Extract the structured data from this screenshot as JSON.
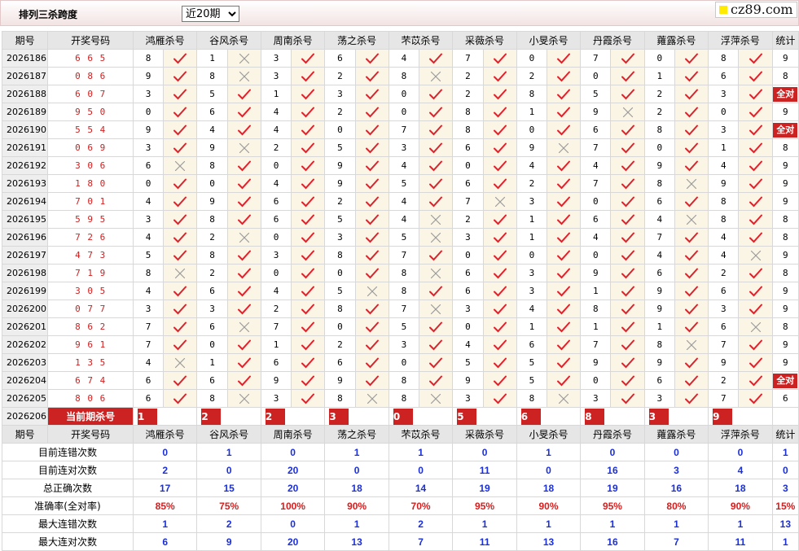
{
  "header": {
    "title": "排列三杀跨度",
    "period_select": {
      "value": "近20期",
      "options": [
        "近20期"
      ]
    },
    "logo": "cz89.com"
  },
  "columns": [
    "期号",
    "开奖号码",
    "鸿雁杀号",
    "谷风杀号",
    "周南杀号",
    "荡之杀号",
    "芣苡杀号",
    "采薇杀号",
    "小旻杀号",
    "丹霞杀号",
    "蕹露杀号",
    "浮萍杀号",
    "统计"
  ],
  "rows": [
    {
      "issue": "2026186",
      "code": "6 6 5",
      "picks": [
        [
          "8",
          1
        ],
        [
          "1",
          0
        ],
        [
          "3",
          1
        ],
        [
          "6",
          1
        ],
        [
          "4",
          1
        ],
        [
          "7",
          1
        ],
        [
          "0",
          1
        ],
        [
          "7",
          1
        ],
        [
          "0",
          1
        ],
        [
          "8",
          1
        ]
      ],
      "count": "9"
    },
    {
      "issue": "2026187",
      "code": "0 8 6",
      "picks": [
        [
          "9",
          1
        ],
        [
          "8",
          0
        ],
        [
          "3",
          1
        ],
        [
          "2",
          1
        ],
        [
          "8",
          0
        ],
        [
          "2",
          1
        ],
        [
          "2",
          1
        ],
        [
          "0",
          1
        ],
        [
          "1",
          1
        ],
        [
          "6",
          1
        ]
      ],
      "count": "8"
    },
    {
      "issue": "2026188",
      "code": "6 0 7",
      "picks": [
        [
          "3",
          1
        ],
        [
          "5",
          1
        ],
        [
          "1",
          1
        ],
        [
          "3",
          1
        ],
        [
          "0",
          1
        ],
        [
          "2",
          1
        ],
        [
          "8",
          1
        ],
        [
          "5",
          1
        ],
        [
          "2",
          1
        ],
        [
          "3",
          1
        ]
      ],
      "count": "全对"
    },
    {
      "issue": "2026189",
      "code": "9 5 0",
      "picks": [
        [
          "0",
          1
        ],
        [
          "6",
          1
        ],
        [
          "4",
          1
        ],
        [
          "2",
          1
        ],
        [
          "0",
          1
        ],
        [
          "8",
          1
        ],
        [
          "1",
          1
        ],
        [
          "9",
          0
        ],
        [
          "2",
          1
        ],
        [
          "0",
          1
        ]
      ],
      "count": "9"
    },
    {
      "issue": "2026190",
      "code": "5 5 4",
      "picks": [
        [
          "9",
          1
        ],
        [
          "4",
          1
        ],
        [
          "4",
          1
        ],
        [
          "0",
          1
        ],
        [
          "7",
          1
        ],
        [
          "8",
          1
        ],
        [
          "0",
          1
        ],
        [
          "6",
          1
        ],
        [
          "8",
          1
        ],
        [
          "3",
          1
        ]
      ],
      "count": "全对"
    },
    {
      "issue": "2026191",
      "code": "0 6 9",
      "picks": [
        [
          "3",
          1
        ],
        [
          "9",
          0
        ],
        [
          "2",
          1
        ],
        [
          "5",
          1
        ],
        [
          "3",
          1
        ],
        [
          "6",
          1
        ],
        [
          "9",
          0
        ],
        [
          "7",
          1
        ],
        [
          "0",
          1
        ],
        [
          "1",
          1
        ]
      ],
      "count": "8"
    },
    {
      "issue": "2026192",
      "code": "3 0 6",
      "picks": [
        [
          "6",
          0
        ],
        [
          "8",
          1
        ],
        [
          "0",
          1
        ],
        [
          "9",
          1
        ],
        [
          "4",
          1
        ],
        [
          "0",
          1
        ],
        [
          "4",
          1
        ],
        [
          "4",
          1
        ],
        [
          "9",
          1
        ],
        [
          "4",
          1
        ]
      ],
      "count": "9"
    },
    {
      "issue": "2026193",
      "code": "1 8 0",
      "picks": [
        [
          "0",
          1
        ],
        [
          "0",
          1
        ],
        [
          "4",
          1
        ],
        [
          "9",
          1
        ],
        [
          "5",
          1
        ],
        [
          "6",
          1
        ],
        [
          "2",
          1
        ],
        [
          "7",
          1
        ],
        [
          "8",
          0
        ],
        [
          "9",
          1
        ]
      ],
      "count": "9"
    },
    {
      "issue": "2026194",
      "code": "7 0 1",
      "picks": [
        [
          "4",
          1
        ],
        [
          "9",
          1
        ],
        [
          "6",
          1
        ],
        [
          "2",
          1
        ],
        [
          "4",
          1
        ],
        [
          "7",
          0
        ],
        [
          "3",
          1
        ],
        [
          "0",
          1
        ],
        [
          "6",
          1
        ],
        [
          "8",
          1
        ]
      ],
      "count": "9"
    },
    {
      "issue": "2026195",
      "code": "5 9 5",
      "picks": [
        [
          "3",
          1
        ],
        [
          "8",
          1
        ],
        [
          "6",
          1
        ],
        [
          "5",
          1
        ],
        [
          "4",
          0
        ],
        [
          "2",
          1
        ],
        [
          "1",
          1
        ],
        [
          "6",
          1
        ],
        [
          "4",
          0
        ],
        [
          "8",
          1
        ]
      ],
      "count": "8"
    },
    {
      "issue": "2026196",
      "code": "7 2 6",
      "picks": [
        [
          "4",
          1
        ],
        [
          "2",
          0
        ],
        [
          "0",
          1
        ],
        [
          "3",
          1
        ],
        [
          "5",
          0
        ],
        [
          "3",
          1
        ],
        [
          "1",
          1
        ],
        [
          "4",
          1
        ],
        [
          "7",
          1
        ],
        [
          "4",
          1
        ]
      ],
      "count": "8"
    },
    {
      "issue": "2026197",
      "code": "4 7 3",
      "picks": [
        [
          "5",
          1
        ],
        [
          "8",
          1
        ],
        [
          "3",
          1
        ],
        [
          "8",
          1
        ],
        [
          "7",
          1
        ],
        [
          "0",
          1
        ],
        [
          "0",
          1
        ],
        [
          "0",
          1
        ],
        [
          "4",
          1
        ],
        [
          "4",
          0
        ]
      ],
      "count": "9"
    },
    {
      "issue": "2026198",
      "code": "7 1 9",
      "picks": [
        [
          "8",
          0
        ],
        [
          "2",
          1
        ],
        [
          "0",
          1
        ],
        [
          "0",
          1
        ],
        [
          "8",
          0
        ],
        [
          "6",
          1
        ],
        [
          "3",
          1
        ],
        [
          "9",
          1
        ],
        [
          "6",
          1
        ],
        [
          "2",
          1
        ]
      ],
      "count": "8"
    },
    {
      "issue": "2026199",
      "code": "3 0 5",
      "picks": [
        [
          "4",
          1
        ],
        [
          "6",
          1
        ],
        [
          "4",
          1
        ],
        [
          "5",
          0
        ],
        [
          "8",
          1
        ],
        [
          "6",
          1
        ],
        [
          "3",
          1
        ],
        [
          "1",
          1
        ],
        [
          "9",
          1
        ],
        [
          "6",
          1
        ]
      ],
      "count": "9"
    },
    {
      "issue": "2026200",
      "code": "0 7 7",
      "picks": [
        [
          "3",
          1
        ],
        [
          "3",
          1
        ],
        [
          "2",
          1
        ],
        [
          "8",
          1
        ],
        [
          "7",
          0
        ],
        [
          "3",
          1
        ],
        [
          "4",
          1
        ],
        [
          "8",
          1
        ],
        [
          "9",
          1
        ],
        [
          "3",
          1
        ]
      ],
      "count": "9"
    },
    {
      "issue": "2026201",
      "code": "8 6 2",
      "picks": [
        [
          "7",
          1
        ],
        [
          "6",
          0
        ],
        [
          "7",
          1
        ],
        [
          "0",
          1
        ],
        [
          "5",
          1
        ],
        [
          "0",
          1
        ],
        [
          "1",
          1
        ],
        [
          "1",
          1
        ],
        [
          "1",
          1
        ],
        [
          "6",
          0
        ]
      ],
      "count": "8"
    },
    {
      "issue": "2026202",
      "code": "9 6 1",
      "picks": [
        [
          "7",
          1
        ],
        [
          "0",
          1
        ],
        [
          "1",
          1
        ],
        [
          "2",
          1
        ],
        [
          "3",
          1
        ],
        [
          "4",
          1
        ],
        [
          "6",
          1
        ],
        [
          "7",
          1
        ],
        [
          "8",
          0
        ],
        [
          "7",
          1
        ]
      ],
      "count": "9"
    },
    {
      "issue": "2026203",
      "code": "1 3 5",
      "picks": [
        [
          "4",
          0
        ],
        [
          "1",
          1
        ],
        [
          "6",
          1
        ],
        [
          "6",
          1
        ],
        [
          "0",
          1
        ],
        [
          "5",
          1
        ],
        [
          "5",
          1
        ],
        [
          "9",
          1
        ],
        [
          "9",
          1
        ],
        [
          "9",
          1
        ]
      ],
      "count": "9"
    },
    {
      "issue": "2026204",
      "code": "6 7 4",
      "picks": [
        [
          "6",
          1
        ],
        [
          "6",
          1
        ],
        [
          "9",
          1
        ],
        [
          "9",
          1
        ],
        [
          "8",
          1
        ],
        [
          "9",
          1
        ],
        [
          "5",
          1
        ],
        [
          "0",
          1
        ],
        [
          "6",
          1
        ],
        [
          "2",
          1
        ]
      ],
      "count": "全对"
    },
    {
      "issue": "2026205",
      "code": "8 0 6",
      "picks": [
        [
          "6",
          1
        ],
        [
          "8",
          0
        ],
        [
          "3",
          1
        ],
        [
          "8",
          0
        ],
        [
          "8",
          0
        ],
        [
          "3",
          1
        ],
        [
          "8",
          0
        ],
        [
          "3",
          1
        ],
        [
          "3",
          1
        ],
        [
          "7",
          1
        ]
      ],
      "count": "6"
    }
  ],
  "current": {
    "issue": "2026206",
    "label": "当前期杀号",
    "picks": [
      "1",
      "2",
      "2",
      "3",
      "0",
      "5",
      "6",
      "8",
      "3",
      "9"
    ]
  },
  "stats": [
    {
      "label": "目前连错次数",
      "values": [
        "0",
        "1",
        "0",
        "1",
        "1",
        "0",
        "1",
        "0",
        "0",
        "0",
        "1"
      ],
      "red": false
    },
    {
      "label": "目前连对次数",
      "values": [
        "2",
        "0",
        "20",
        "0",
        "0",
        "11",
        "0",
        "16",
        "3",
        "4",
        "0"
      ],
      "red": false
    },
    {
      "label": "总正确次数",
      "values": [
        "17",
        "15",
        "20",
        "18",
        "14",
        "19",
        "18",
        "19",
        "16",
        "18",
        "3"
      ],
      "red": false
    },
    {
      "label": "准确率(全对率)",
      "values": [
        "85%",
        "75%",
        "100%",
        "90%",
        "70%",
        "95%",
        "90%",
        "95%",
        "80%",
        "90%",
        "15%"
      ],
      "red": true
    },
    {
      "label": "最大连错次数",
      "values": [
        "1",
        "2",
        "0",
        "1",
        "2",
        "1",
        "1",
        "1",
        "1",
        "1",
        "13"
      ],
      "red": false
    },
    {
      "label": "最大连对次数",
      "values": [
        "6",
        "9",
        "20",
        "13",
        "7",
        "11",
        "13",
        "16",
        "7",
        "11",
        "1"
      ],
      "red": false
    }
  ],
  "icons": {
    "correct": "check-icon",
    "wrong": "cross-icon"
  },
  "colors": {
    "check": "#e0202a",
    "cross": "#9a9a9a",
    "stat_value": "#1b2fd9",
    "accuracy": "#d61e1e",
    "highlight": "#cc2222"
  }
}
